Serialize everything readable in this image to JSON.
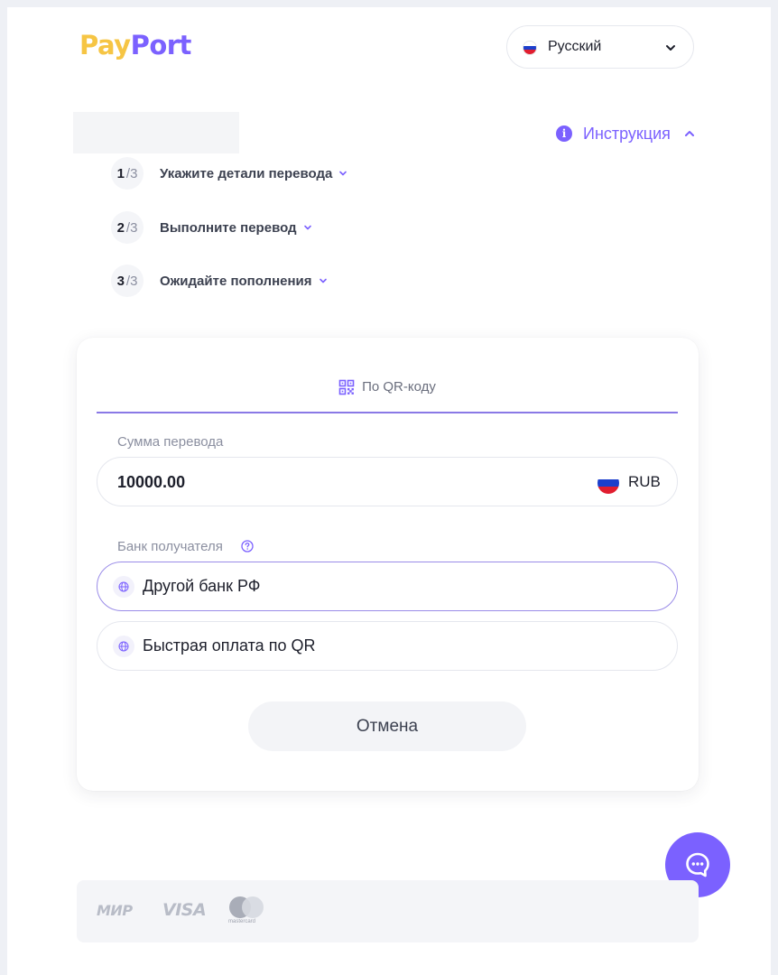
{
  "brand": {
    "logo_part1": "Pay",
    "logo_part2": "Port"
  },
  "language": {
    "selected": "Русский",
    "flag_icon": "russia-flag-icon"
  },
  "instructions": {
    "label": "Инструкция"
  },
  "steps": [
    {
      "number": "1",
      "total": "/3",
      "label": "Укажите детали перевода"
    },
    {
      "number": "2",
      "total": "/3",
      "label": "Выполните перевод"
    },
    {
      "number": "3",
      "total": "/3",
      "label": "Ожидайте пополнения"
    }
  ],
  "payment": {
    "tab_label": "По QR-коду",
    "amount_label": "Сумма перевода",
    "amount_value": "10000.00",
    "currency": "RUB",
    "bank_label": "Банк получателя",
    "bank_options": [
      {
        "label": "Другой банк РФ",
        "selected": true
      },
      {
        "label": "Быстрая оплата по QR",
        "selected": false
      }
    ],
    "cancel_label": "Отмена"
  },
  "footer": {
    "mir_logo": "МИР",
    "visa_logo": "VISA",
    "mastercard_label": "mastercard"
  },
  "colors": {
    "accent": "#7b61ff",
    "logo_yellow": "#f6c544",
    "text_dark": "#1d1f2b",
    "muted": "#8b8fa0"
  }
}
